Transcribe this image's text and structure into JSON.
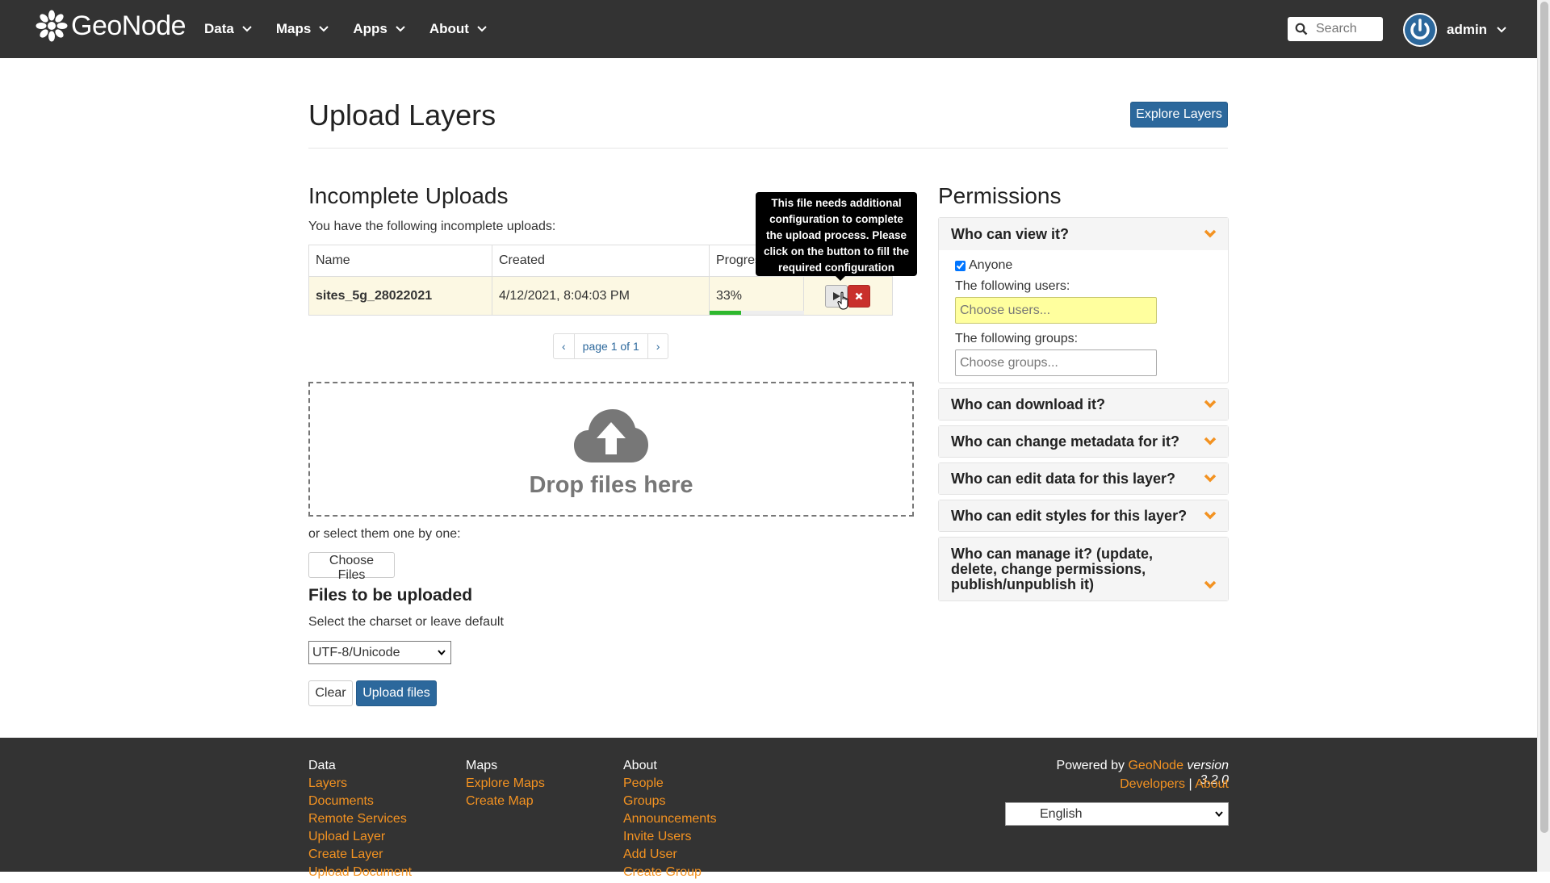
{
  "navbar": {
    "brand": "GeoNode",
    "menu": [
      {
        "label": "Data"
      },
      {
        "label": "Maps"
      },
      {
        "label": "Apps"
      },
      {
        "label": "About"
      }
    ],
    "search_placeholder": "Search",
    "user": "admin"
  },
  "header": {
    "title": "Upload Layers",
    "explore_button": "Explore Layers"
  },
  "incomplete": {
    "title": "Incomplete Uploads",
    "description": "You have the following incomplete uploads:",
    "columns": [
      "Name",
      "Created",
      "Progress"
    ],
    "rows": [
      {
        "name": "sites_5g_28022021",
        "created": "4/12/2021, 8:04:03 PM",
        "progress": "33%",
        "progress_value": 0.33
      }
    ],
    "pagination": {
      "prev": "‹",
      "page_label": "page 1 of 1",
      "next": "›"
    },
    "tooltip": "This file needs additional configuration to complete the upload process. Please click on the button to fill the required configuration"
  },
  "upload": {
    "drop_text": "Drop files here",
    "or_select": "or select them one by one:",
    "choose_button": "Choose Files",
    "files_title": "Files to be uploaded",
    "charset_label": "Select the charset or leave default",
    "charset_value": "UTF-8/Unicode",
    "clear_button": "Clear",
    "upload_button": "Upload files"
  },
  "permissions": {
    "title": "Permissions",
    "view": {
      "heading": "Who can view it?",
      "anyone_label": "Anyone",
      "anyone_checked": true,
      "users_label": "The following users:",
      "users_placeholder": "Choose users...",
      "groups_label": "The following groups:",
      "groups_placeholder": "Choose groups..."
    },
    "download": "Who can download it?",
    "change_metadata": "Who can change metadata for it?",
    "edit_data": "Who can edit data for this layer?",
    "edit_styles": "Who can edit styles for this layer?",
    "manage": "Who can manage it? (update, delete, change permissions, publish/unpublish it)"
  },
  "footer": {
    "data": {
      "heading": "Data",
      "links": [
        "Layers",
        "Documents",
        "Remote Services",
        "Upload Layer",
        "Create Layer",
        "Upload Document"
      ]
    },
    "maps": {
      "heading": "Maps",
      "links": [
        "Explore Maps",
        "Create Map"
      ]
    },
    "about": {
      "heading": "About",
      "links": [
        "People",
        "Groups",
        "Announcements",
        "Invite Users",
        "Add User",
        "Create Group"
      ]
    },
    "powered_prefix": "Powered by",
    "powered_name": "GeoNode",
    "version": "version 3.2.0",
    "developers": "Developers",
    "separator": "|",
    "about_link": "About",
    "language": "English"
  },
  "colors": {
    "navbar": "#333333",
    "primary": "#2c689c",
    "accent_orange": "#f39221",
    "danger": "#c9302c",
    "progress": "#2eb82e",
    "row_highlight": "#fcf8e3"
  }
}
